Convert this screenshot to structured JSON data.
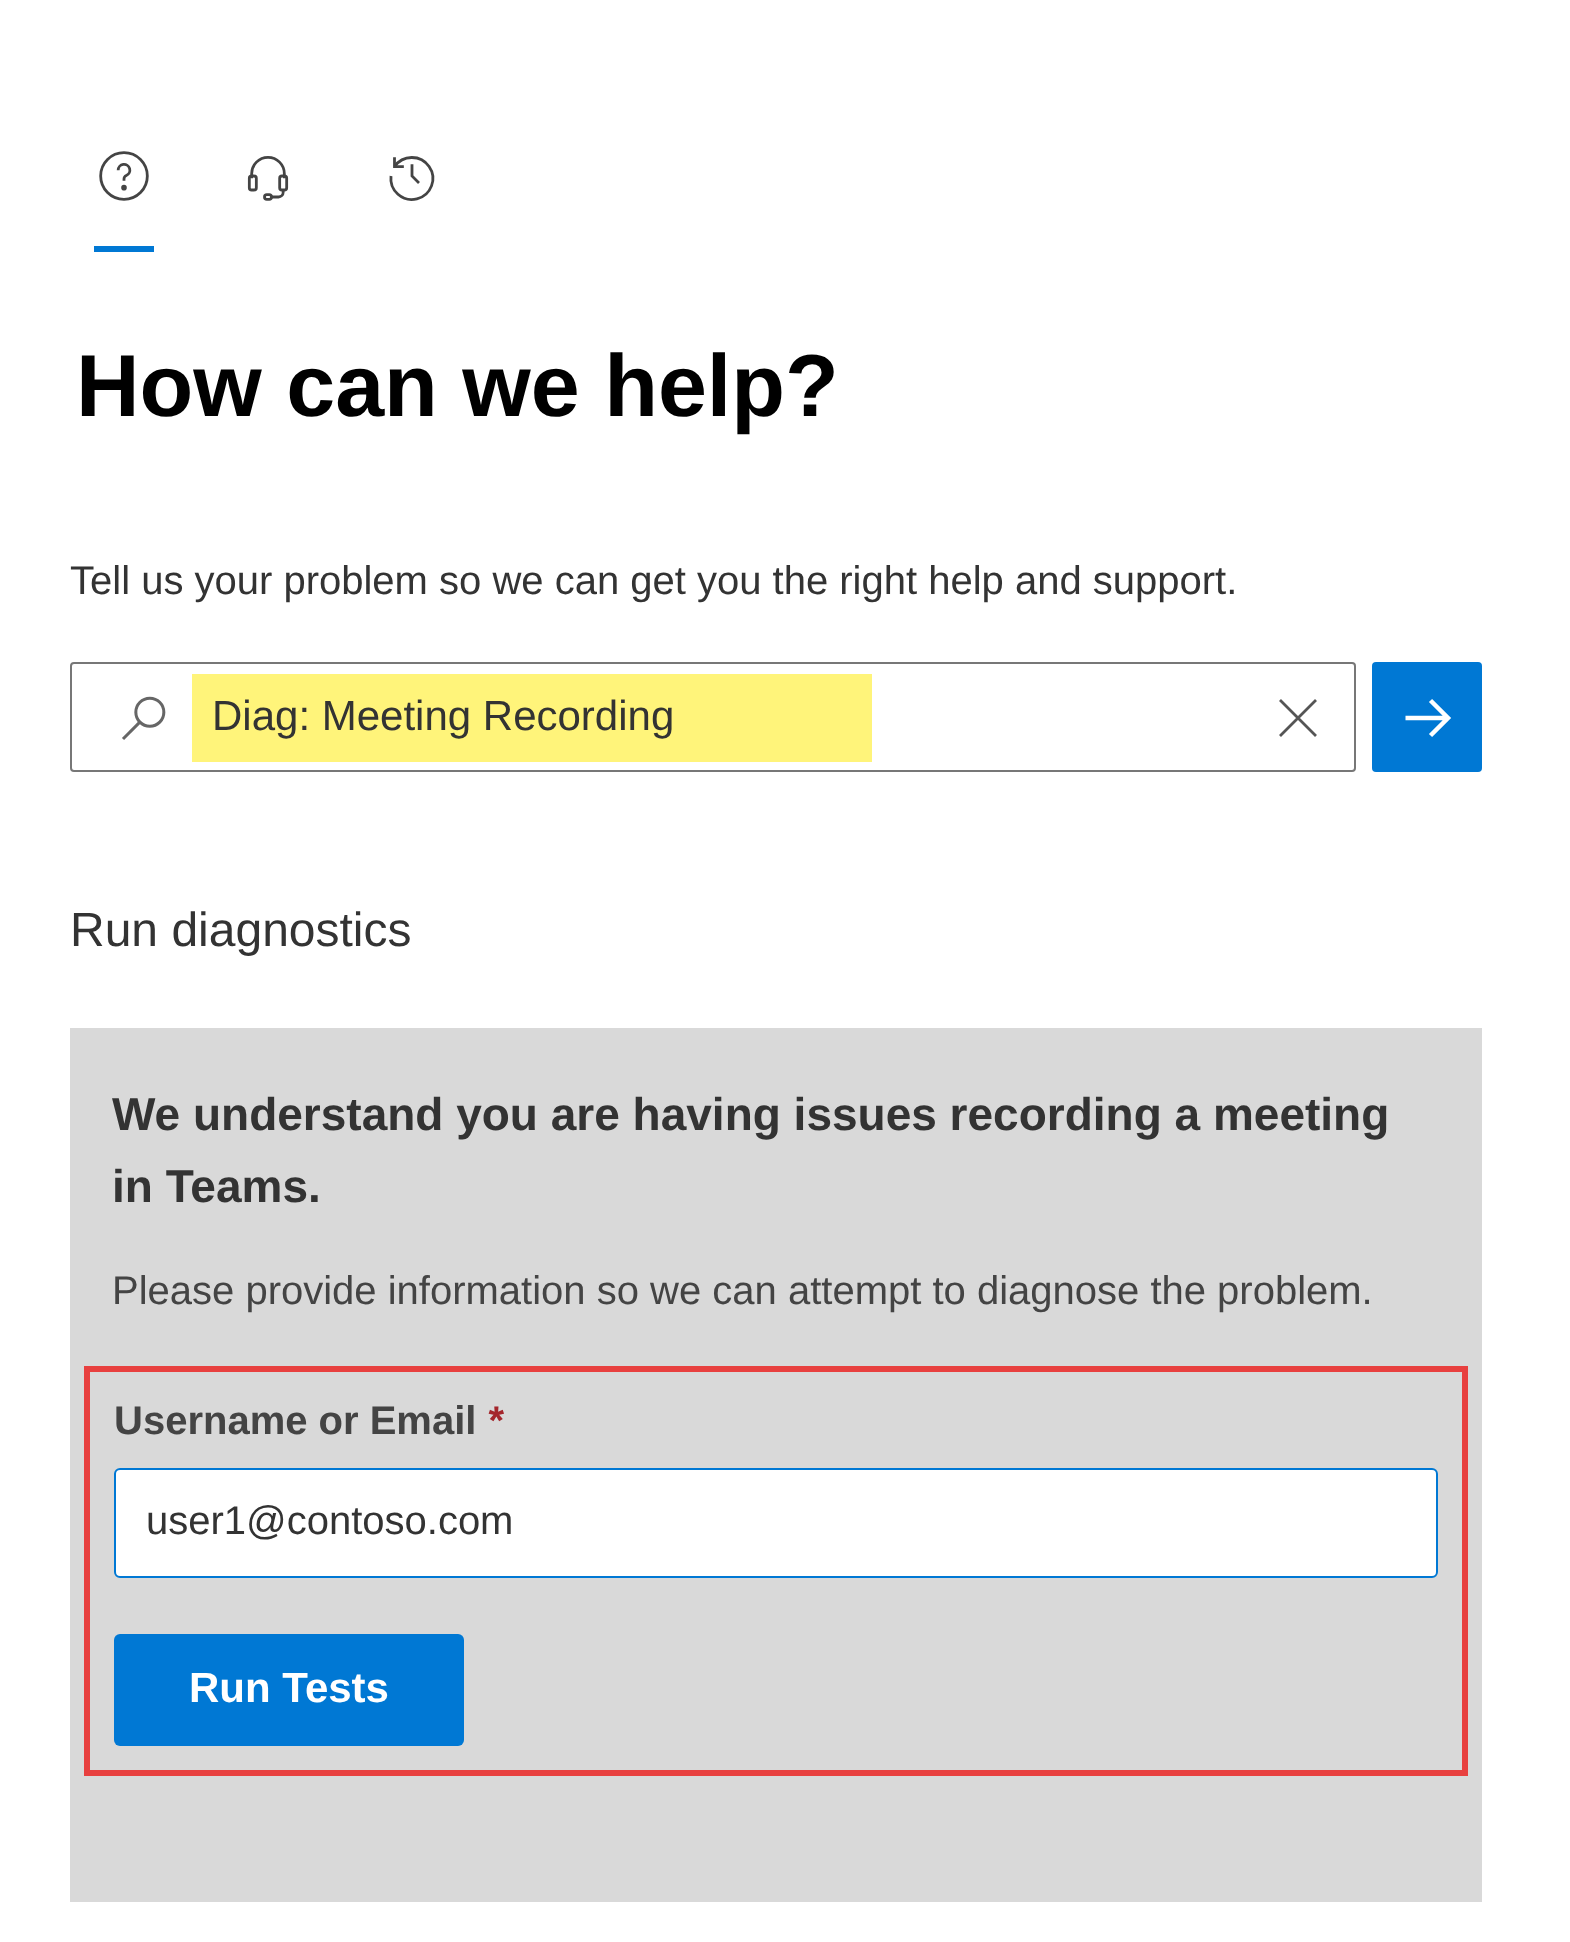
{
  "tabs": [
    {
      "kind": "help",
      "selected": true
    },
    {
      "kind": "support",
      "selected": false
    },
    {
      "kind": "history",
      "selected": false
    }
  ],
  "heading": "How can we help?",
  "intro": "Tell us your problem so we can get you the right help and support.",
  "search": {
    "value": "Diag: Meeting Recording",
    "highlighted": true
  },
  "section_title": "Run diagnostics",
  "panel": {
    "title": "We understand you are having issues recording a meeting in Teams.",
    "description": "Please provide information so we can attempt to diagnose the problem.",
    "outlined": true,
    "field": {
      "label": "Username or Email",
      "required_mark": "*",
      "value": "user1@contoso.com"
    },
    "button": "Run Tests"
  }
}
